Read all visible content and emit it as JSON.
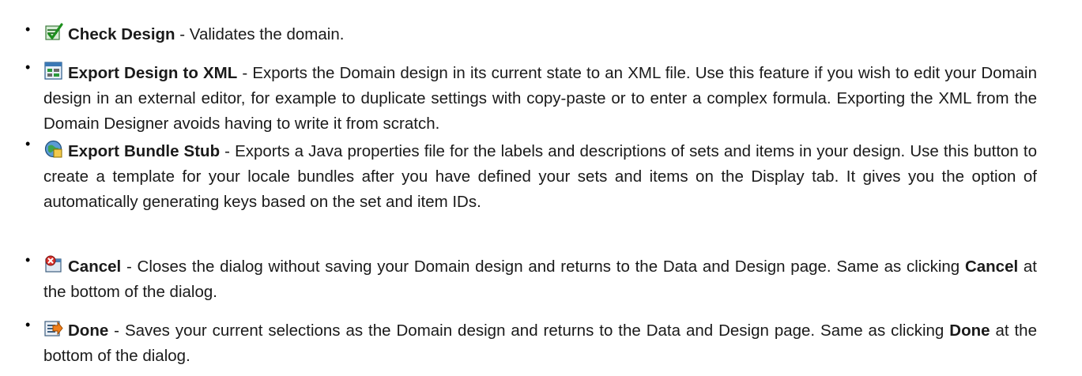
{
  "items": [
    {
      "icon": "check-design-icon",
      "title": "Check Design",
      "desc": " - Validates the domain."
    },
    {
      "icon": "export-xml-icon",
      "title": "Export Design to XML",
      "desc": " - Exports the Domain design in its current state to an XML file. Use this feature if you wish to edit your Domain design in an external editor, for example to duplicate settings with copy-paste or to enter a complex formula. Exporting the XML from the Domain Designer avoids having to write it from scratch."
    },
    {
      "icon": "export-bundle-icon",
      "title": "Export Bundle Stub",
      "desc": " - Exports a Java properties file for the labels and descriptions of sets and items in your design. Use this button to create a template for your locale bundles after you have defined your sets and items on the Display tab. It gives you the option of automatically generating keys based on the set and item IDs."
    },
    {
      "icon": "cancel-icon",
      "title": "Cancel",
      "desc": " - Closes the dialog without saving your Domain design and returns to the Data and Design page. Same as clicking ",
      "emph": "Cancel",
      "tail": " at the bottom of the dialog."
    },
    {
      "icon": "done-icon",
      "title": "Done",
      "desc": " - Saves your current selections as the Domain design and returns to the Data and Design page. Same as clicking ",
      "emph": "Done",
      "tail": " at the bottom of the dialog."
    }
  ]
}
